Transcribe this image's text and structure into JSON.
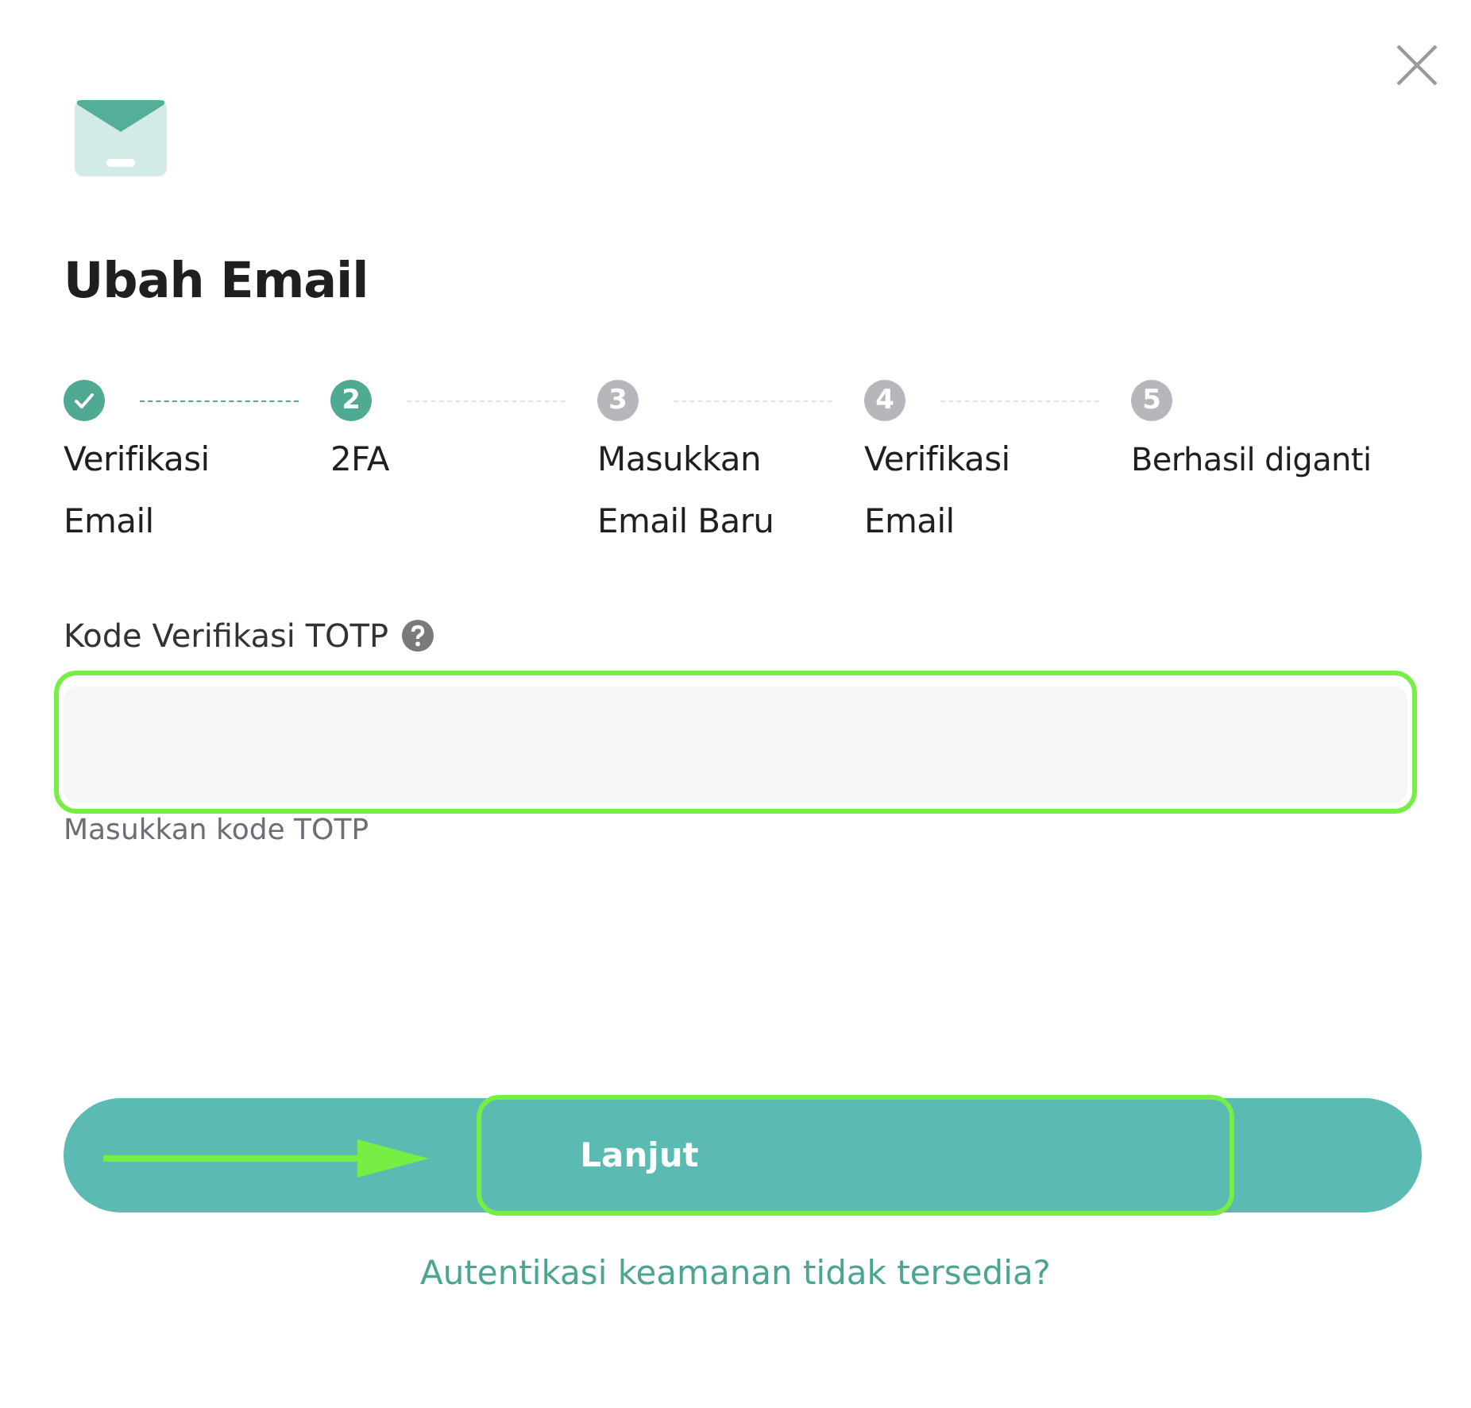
{
  "dialog": {
    "title": "Ubah Email"
  },
  "steps": [
    {
      "label": "Verifikasi Email",
      "completed": true,
      "current": false
    },
    {
      "number": "2",
      "label": "2FA",
      "completed": false,
      "current": true
    },
    {
      "number": "3",
      "label": "Masukkan Email Baru",
      "completed": false,
      "current": false
    },
    {
      "number": "4",
      "label": "Verifikasi Email",
      "completed": false,
      "current": false
    },
    {
      "number": "5",
      "label": "Berhasil diganti",
      "completed": false,
      "current": false
    }
  ],
  "field": {
    "label": "Kode Verifikasi TOTP",
    "hint": "Masukkan kode TOTP",
    "highlighted": true
  },
  "button": {
    "label": "Lanjut",
    "highlighted": true,
    "pointer_arrow": true
  },
  "link": "Autentikasi keamanan tidak tersedia?"
}
